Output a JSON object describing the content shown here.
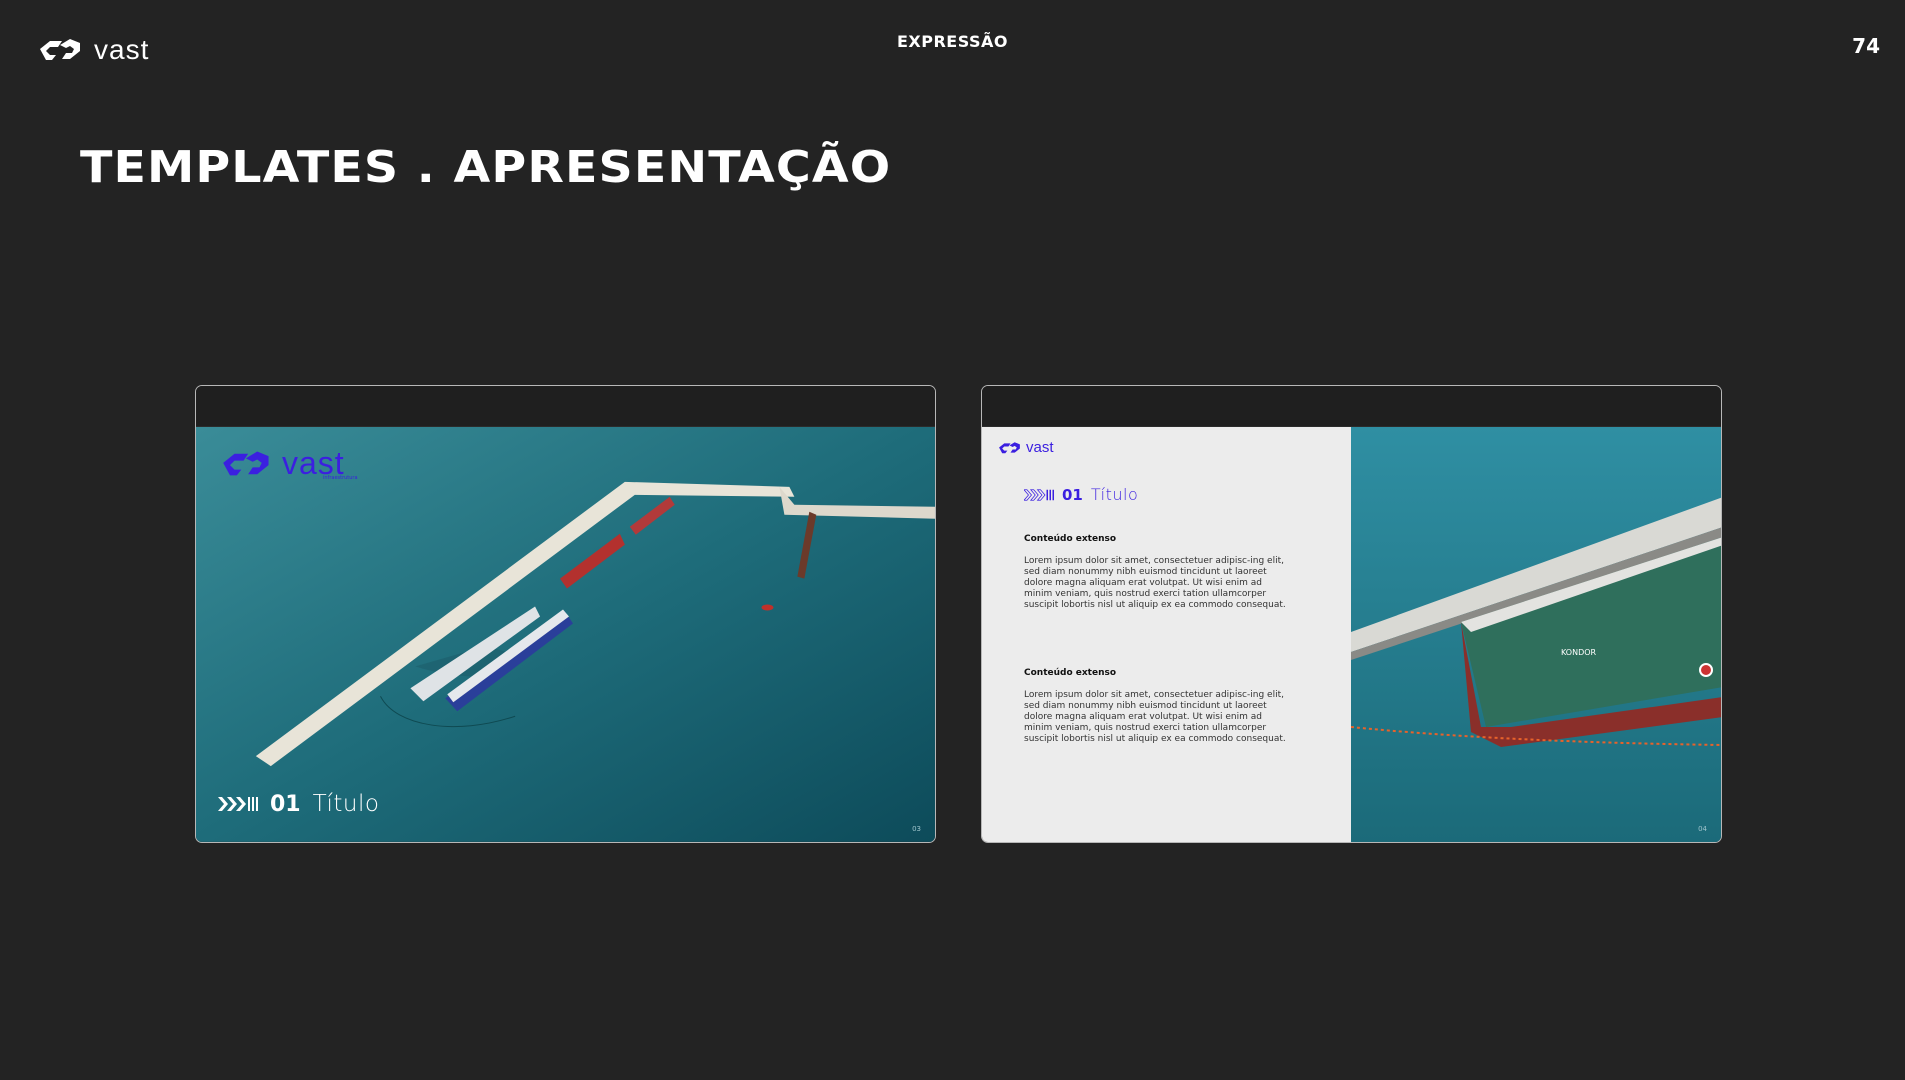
{
  "header": {
    "logo_text": "vast",
    "section": "EXPRESSÃO",
    "page_number": "74"
  },
  "title": "TEMPLATES . APRESENTAÇÃO",
  "slides": [
    {
      "logo_text": "vast",
      "logo_subtext": "infraestrutura",
      "number": "01",
      "title": "Título",
      "page": "03"
    },
    {
      "logo_text": "vast",
      "number": "01",
      "title": "Título",
      "blocks": [
        {
          "heading": "Conteúdo extenso",
          "body": "Lorem ipsum dolor sit amet, consectetuer adipisc-ing elit, sed diam nonummy nibh euismod tincidunt ut laoreet dolore magna aliquam erat volutpat. Ut wisi enim ad minim veniam, quis nostrud exerci tation ullamcorper suscipit lobortis nisl ut aliquip ex ea commodo consequat."
        },
        {
          "heading": "Conteúdo extenso",
          "body": "Lorem ipsum dolor sit amet, consectetuer adipisc-ing elit, sed diam nonummy nibh euismod tincidunt ut laoreet dolore magna aliquam erat volutpat. Ut wisi enim ad minim veniam, quis nostrud exerci tation ullamcorper suscipit lobortis nisl ut aliquip ex ea commodo consequat."
        }
      ],
      "ship_name": "KONDOR",
      "page": "04"
    }
  ],
  "colors": {
    "background": "#232323",
    "brand_violet": "#3b1fe0",
    "sea": "#1c6b78"
  }
}
